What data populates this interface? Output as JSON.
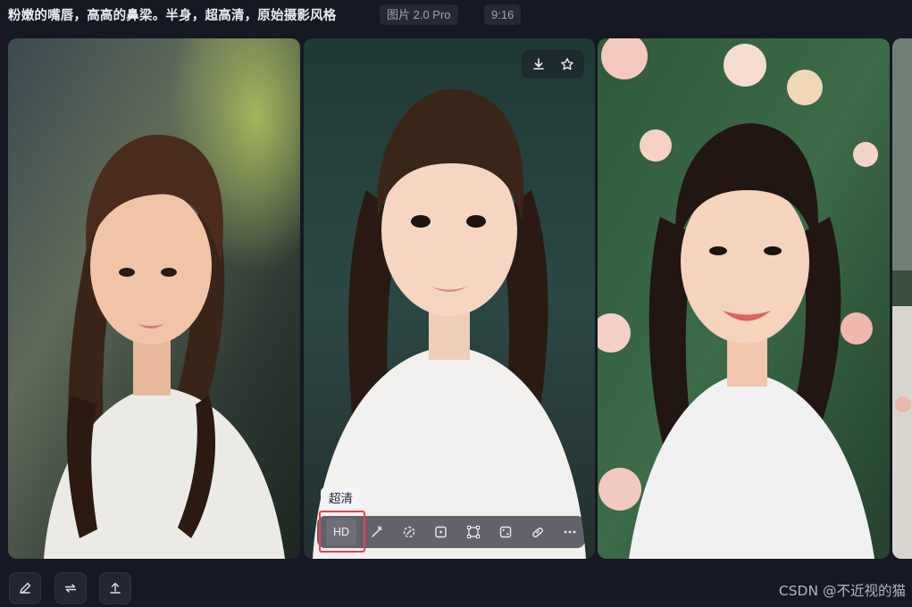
{
  "prompt": {
    "text": "粉嫩的嘴唇，高高的鼻梁。半身，超高清，原始摄影风格",
    "model_chip": "图片 2.0 Pro",
    "ratio_chip": "9:16"
  },
  "gallery": {
    "images": [
      {
        "subject": "photo-portrait-girl-braids-garden-light"
      },
      {
        "subject": "photo-portrait-girl-braids-closeup"
      },
      {
        "subject": "photo-portrait-girl-braids-roses"
      },
      {
        "subject": "photo-partial-next-image"
      }
    ],
    "top_actions": {
      "icons": [
        "download-icon",
        "star-icon"
      ]
    },
    "tooltip": "超清",
    "toolbar": {
      "hd_label": "HD",
      "icons": [
        "magic-wand-icon",
        "eraser-icon",
        "video-add-icon",
        "expand-frame-icon",
        "crop-icon",
        "brush-icon",
        "more-icon"
      ]
    },
    "highlight_color": "#ee3f52"
  },
  "bottom_bar": {
    "icons": [
      "edit-icon",
      "regenerate-icon",
      "upload-icon"
    ],
    "watermark": "CSDN @不近视的猫"
  },
  "colors": {
    "background": "#161823",
    "chip": "#262935",
    "accent": "#ee3f52"
  }
}
